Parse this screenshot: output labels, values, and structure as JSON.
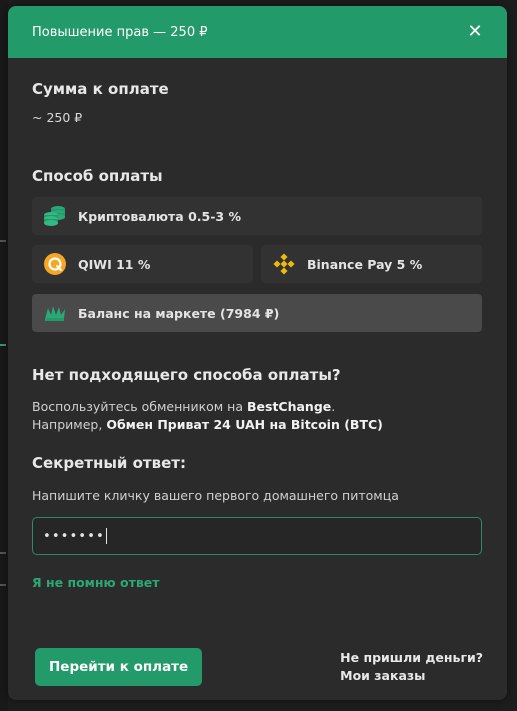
{
  "modal": {
    "title": "Повышение прав — 250 ₽",
    "close_glyph": "✕"
  },
  "amount": {
    "heading": "Сумма к оплате",
    "value": "~ 250 ₽"
  },
  "payment": {
    "heading": "Способ оплаты",
    "methods": [
      {
        "label": "Криптовалюта 0.5-3 %",
        "icon": "coins-icon",
        "color": "#2aa876"
      },
      {
        "label": "QIWI 11 %",
        "icon": "qiwi-icon",
        "color": "#f5a623"
      },
      {
        "label": "Binance Pay 5 %",
        "icon": "binance-icon",
        "color": "#f0b90b"
      },
      {
        "label": "Баланс на маркете (7984 ₽)",
        "icon": "market-balance-icon",
        "color": "#2aa876",
        "selected": true
      }
    ]
  },
  "no_method": {
    "heading": "Нет подходящего способа оплаты?",
    "line1_prefix": "Воспользуйтесь обменником на",
    "line1_link": "BestChange",
    "line1_suffix": ".",
    "line2_prefix": "Например,",
    "line2_link": "Обмен Приват 24 UAH на Bitcoin (BTC)"
  },
  "secret": {
    "heading": "Секретный ответ:",
    "hint": "Напишите кличку вашего первого домашнего питомца",
    "value": "•••••••",
    "forgot_link": "Я не помню ответ"
  },
  "footer": {
    "pay_button": "Перейти к оплате",
    "no_money_link": "Не пришли деньги?",
    "orders_link": "Мои заказы"
  },
  "colors": {
    "accent": "#239a6a",
    "panel": "#2b2b2b",
    "method_bg": "#323232",
    "method_selected_bg": "#4a4a4a"
  }
}
